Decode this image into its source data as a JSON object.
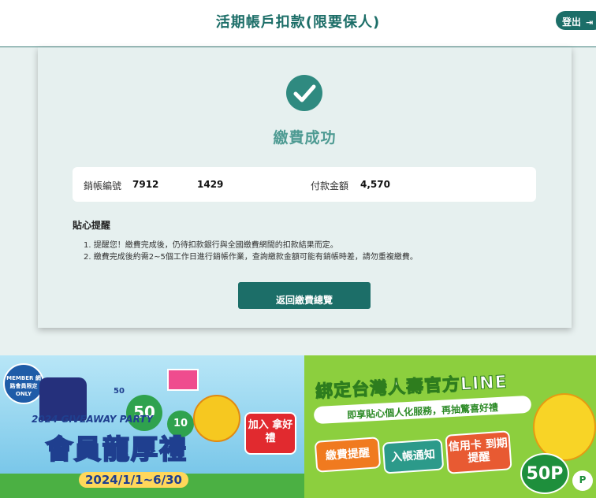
{
  "header": {
    "title": "活期帳戶扣款(限要保人)",
    "logout_label": "登出",
    "logout_icon": "exit-icon"
  },
  "result": {
    "icon": "check-circle-icon",
    "message": "繳費成功"
  },
  "info": {
    "account_label": "銷帳編號",
    "account_part1": "7912",
    "account_part2": "1429",
    "amount_label": "付款金額",
    "amount_value": "4,570"
  },
  "tips": {
    "title": "貼心提醒",
    "items": [
      "1. 提醒您！繳費完成後，仍待扣款銀行與全國繳費網間的扣款結果而定。",
      "2. 繳費完成後約需2~5個工作日進行銷帳作業，查詢繳款金額可能有銷帳時差，請勿重複繳費。"
    ]
  },
  "actions": {
    "back_label": "返回繳費總覽"
  },
  "banner_left": {
    "badge": "MEMBER 網路會員限定 ONLY",
    "party": "2024 GIVEAWAY PARTY",
    "headline": "會員龍厚禮",
    "dates": "2024/1/1~6/30",
    "coin_big": "50",
    "coin_small": "10",
    "coin_label": "50",
    "join": "加入 拿好禮"
  },
  "banner_right": {
    "headline": "綁定台灣人壽官方LINE",
    "subline": "即享貼心個人化服務，再抽驚喜好禮",
    "tag1": "繳費提醒",
    "tag2": "入帳通知",
    "tag3": "信用卡 到期提醒",
    "points": "50P",
    "bubble": "P"
  }
}
